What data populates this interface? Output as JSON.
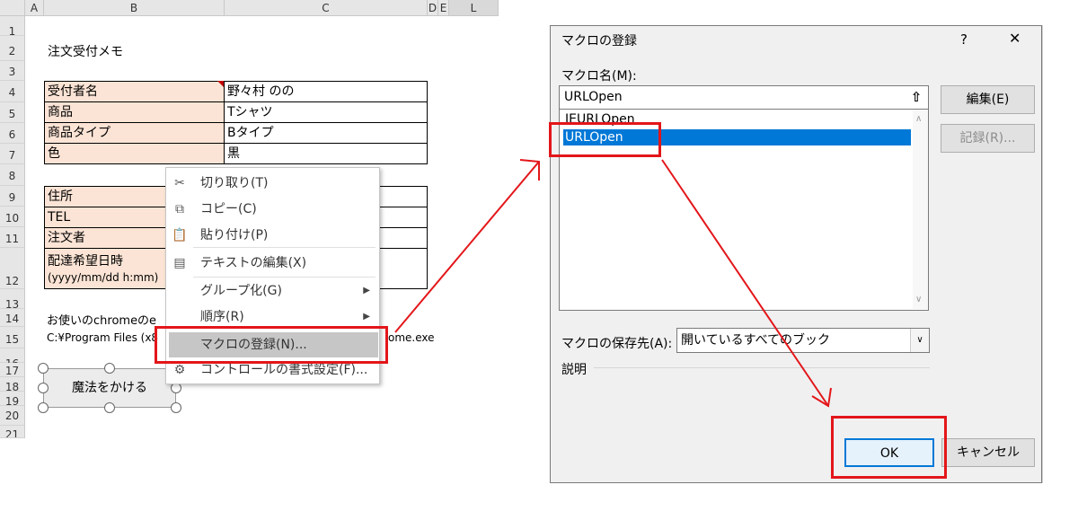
{
  "sheet": {
    "columns": [
      "A",
      "B",
      "C",
      "D",
      "E",
      "L"
    ],
    "rows": [
      "1",
      "2",
      "3",
      "4",
      "5",
      "6",
      "7",
      "8",
      "9",
      "10",
      "11",
      "12",
      "13",
      "14",
      "15",
      "16",
      "17",
      "18",
      "19",
      "20",
      "21"
    ],
    "title": "注文受付メモ",
    "table1": [
      {
        "key": "受付者名",
        "value": "野々村 のの"
      },
      {
        "key": "商品",
        "value": "Tシャツ"
      },
      {
        "key": "商品タイプ",
        "value": "Bタイプ"
      },
      {
        "key": "色",
        "value": "黒"
      }
    ],
    "table2": [
      {
        "key": "住所"
      },
      {
        "key": "TEL"
      },
      {
        "key": "注文者"
      },
      {
        "key": "配達希望日時",
        "sub": "(yyyy/mm/dd h:mm)"
      }
    ],
    "note1": "お使いのchromeのe",
    "note2": "C:¥Program Files (x8",
    "note2_tail": "ome.exe",
    "button_label": "魔法をかける"
  },
  "context_menu": {
    "items": [
      {
        "label": "切り取り(T)",
        "icon": "scissors-icon"
      },
      {
        "label": "コピー(C)",
        "icon": "copy-icon"
      },
      {
        "label": "貼り付け(P)",
        "icon": "paste-icon"
      },
      {
        "label": "テキストの編集(X)",
        "icon": "text-edit-icon"
      },
      {
        "label": "グループ化(G)",
        "icon": ""
      },
      {
        "label": "順序(R)",
        "icon": ""
      },
      {
        "label": "マクロの登録(N)...",
        "icon": ""
      },
      {
        "label": "コントロールの書式設定(F)...",
        "icon": "format-control-icon"
      }
    ]
  },
  "dialog": {
    "title": "マクロの登録",
    "help": "?",
    "close": "✕",
    "macro_name_label": "マクロ名(M):",
    "macro_name_value": "URLOpen",
    "list": [
      "IEURLOpen",
      "URLOpen"
    ],
    "selected": "URLOpen",
    "edit_button": "編集(E)",
    "record_button": "記録(R)...",
    "store_label": "マクロの保存先(A):",
    "store_value": "開いているすべてのブック",
    "description_label": "説明",
    "ok_button": "OK",
    "cancel_button": "キャンセル"
  },
  "colors": {
    "highlight": "#e3161a",
    "selection": "#0078d7",
    "key_fill": "#fbe4d5"
  }
}
